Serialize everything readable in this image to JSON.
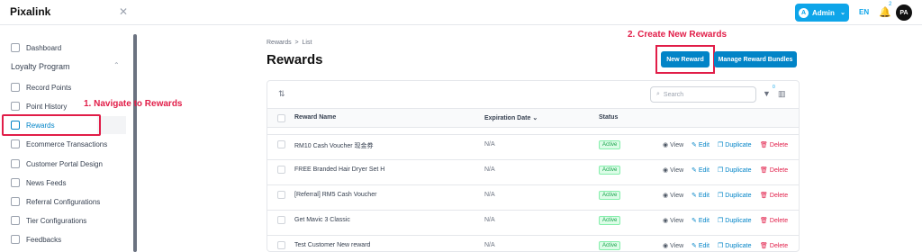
{
  "app": {
    "name": "Pixalink"
  },
  "header": {
    "admin_avatar_letter": "A",
    "admin_label": "Admin",
    "lang": "EN",
    "notification_count": "2",
    "user_initials": "PA"
  },
  "sidebar": {
    "dashboard": "Dashboard",
    "section": "Loyalty Program",
    "items": [
      "Record Points",
      "Point History",
      "Rewards",
      "Ecommerce Transactions",
      "Customer Portal Design",
      "News Feeds",
      "Referral Configurations",
      "Tier Configurations",
      "Feedbacks"
    ]
  },
  "annotations": {
    "step1": "1. Navigate to Rewards",
    "step2": "2. Create New Rewards",
    "color": "#e11d48"
  },
  "page": {
    "breadcrumb": [
      "Rewards",
      "List"
    ],
    "breadcrumb_sep": ">",
    "title": "Rewards",
    "new_button": "New Reward",
    "bundles_button": "Manage Reward Bundles",
    "search_placeholder": "Search",
    "filter_count": "0"
  },
  "table": {
    "headers": {
      "name": "Reward Name",
      "expiration": "Expiration Date",
      "status": "Status"
    },
    "actions": {
      "view": "View",
      "edit": "Edit",
      "duplicate": "Duplicate",
      "delete": "Delete"
    },
    "rows": [
      {
        "name": "RM10 Cash Voucher 现金券",
        "expiration": "N/A",
        "status": "Active"
      },
      {
        "name": "FREE Branded Hair Dryer Set H",
        "expiration": "N/A",
        "status": "Active"
      },
      {
        "name": "[Referral] RM5 Cash Voucher",
        "expiration": "N/A",
        "status": "Active"
      },
      {
        "name": "Get Mavic 3 Classic",
        "expiration": "N/A",
        "status": "Active"
      },
      {
        "name": "Test Customer New reward",
        "expiration": "N/A",
        "status": "Active"
      }
    ]
  },
  "colors": {
    "accent": "#0ea5e9",
    "primary_button": "#0284c7",
    "active_status": "#16a34a",
    "delete": "#e11d48"
  }
}
